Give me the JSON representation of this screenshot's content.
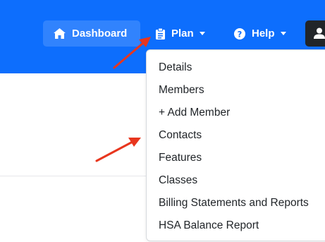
{
  "nav": {
    "dashboard_label": "Dashboard",
    "plan_label": "Plan",
    "help_label": "Help"
  },
  "dropdown": {
    "items": [
      "Details",
      "Members",
      "+ Add Member",
      "Contacts",
      "Features",
      "Classes",
      "Billing Statements and Reports",
      "HSA Balance Report"
    ]
  },
  "colors": {
    "navbar": "#0d6efd",
    "user_button": "#212529",
    "annotation_arrow": "#e8361e"
  },
  "icons": {
    "dashboard": "home-icon",
    "plan": "clipboard-icon",
    "help": "question-circle-icon",
    "user": "user-icon"
  }
}
